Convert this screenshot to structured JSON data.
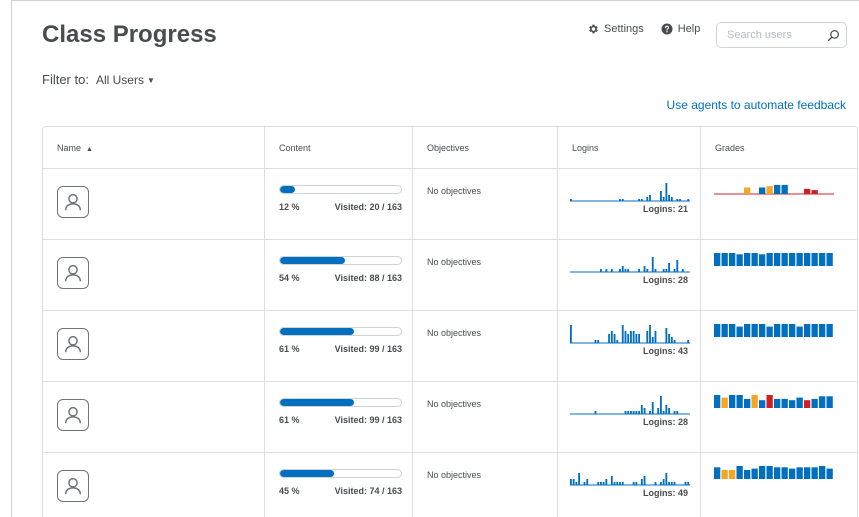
{
  "header": {
    "title": "Class Progress",
    "settings_label": "Settings",
    "help_label": "Help",
    "search_placeholder": "Search users"
  },
  "filter": {
    "label": "Filter to:",
    "value": "All Users"
  },
  "agents_link": "Use agents to automate feedback",
  "columns": {
    "name": "Name",
    "content": "Content",
    "objectives": "Objectives",
    "logins": "Logins",
    "grades": "Grades"
  },
  "colors": {
    "accent": "#006fbf",
    "grade_orange": "#f5a623",
    "grade_red": "#cd2026"
  },
  "rows": [
    {
      "percent_value": 12,
      "percent": "12 %",
      "visited": "Visited: 20 / 163",
      "objectives": "No objectives",
      "logins": "Logins: 21",
      "login_history": [
        1,
        0,
        0,
        0,
        0,
        0,
        0,
        0,
        0,
        0,
        0,
        0,
        0,
        0,
        0,
        0,
        0,
        0,
        1,
        1,
        0,
        0,
        0,
        0,
        0,
        1,
        1,
        0,
        2,
        3,
        0,
        0,
        0,
        5,
        2,
        9,
        3,
        2,
        0,
        1,
        1,
        0,
        0,
        1
      ],
      "grade_style": "line",
      "grades": [
        {
          "v": 0,
          "c": "red"
        },
        {
          "v": 0,
          "c": "red"
        },
        {
          "v": 0,
          "c": "red"
        },
        {
          "v": 0,
          "c": "red"
        },
        {
          "v": 5,
          "c": "orange"
        },
        {
          "v": 0,
          "c": "red"
        },
        {
          "v": 5,
          "c": "blue"
        },
        {
          "v": 6,
          "c": "orange"
        },
        {
          "v": 7,
          "c": "blue"
        },
        {
          "v": 7,
          "c": "blue"
        },
        {
          "v": 0,
          "c": "red"
        },
        {
          "v": 0,
          "c": "red"
        },
        {
          "v": 4,
          "c": "red"
        },
        {
          "v": 3,
          "c": "red"
        },
        {
          "v": 0,
          "c": "red"
        },
        {
          "v": 0,
          "c": "red"
        }
      ]
    },
    {
      "percent_value": 54,
      "percent": "54 %",
      "visited": "Visited: 88 / 163",
      "objectives": "No objectives",
      "logins": "Logins: 28",
      "login_history": [
        0,
        0,
        0,
        0,
        0,
        0,
        0,
        0,
        0,
        0,
        0,
        1,
        0,
        1,
        0,
        1,
        0,
        0,
        1,
        2,
        1,
        1,
        0,
        0,
        0,
        1,
        0,
        2,
        1,
        0,
        5,
        1,
        0,
        0,
        1,
        1,
        3,
        0,
        1,
        4,
        0,
        1,
        0,
        0
      ],
      "grade_style": "full",
      "grades": [
        {
          "v": 10,
          "c": "blue"
        },
        {
          "v": 10,
          "c": "blue"
        },
        {
          "v": 10,
          "c": "blue"
        },
        {
          "v": 9,
          "c": "blue"
        },
        {
          "v": 10,
          "c": "blue"
        },
        {
          "v": 10,
          "c": "blue"
        },
        {
          "v": 9,
          "c": "blue"
        },
        {
          "v": 10,
          "c": "blue"
        },
        {
          "v": 10,
          "c": "blue"
        },
        {
          "v": 10,
          "c": "blue"
        },
        {
          "v": 10,
          "c": "blue"
        },
        {
          "v": 10,
          "c": "blue"
        },
        {
          "v": 10,
          "c": "blue"
        },
        {
          "v": 10,
          "c": "blue"
        },
        {
          "v": 10,
          "c": "blue"
        },
        {
          "v": 10,
          "c": "blue"
        }
      ]
    },
    {
      "percent_value": 61,
      "percent": "61 %",
      "visited": "Visited: 99 / 163",
      "objectives": "No objectives",
      "logins": "Logins: 43",
      "login_history": [
        6,
        0,
        0,
        0,
        0,
        0,
        0,
        0,
        0,
        1,
        1,
        0,
        0,
        0,
        3,
        4,
        3,
        1,
        0,
        6,
        4,
        3,
        4,
        4,
        3,
        3,
        0,
        0,
        4,
        6,
        2,
        4,
        0,
        0,
        0,
        5,
        3,
        2,
        1,
        0,
        0,
        0,
        0,
        1
      ],
      "grade_style": "full",
      "grades": [
        {
          "v": 10,
          "c": "blue"
        },
        {
          "v": 10,
          "c": "blue"
        },
        {
          "v": 10,
          "c": "blue"
        },
        {
          "v": 8,
          "c": "blue"
        },
        {
          "v": 10,
          "c": "blue"
        },
        {
          "v": 10,
          "c": "blue"
        },
        {
          "v": 10,
          "c": "blue"
        },
        {
          "v": 8,
          "c": "blue"
        },
        {
          "v": 10,
          "c": "blue"
        },
        {
          "v": 10,
          "c": "blue"
        },
        {
          "v": 10,
          "c": "blue"
        },
        {
          "v": 8,
          "c": "blue"
        },
        {
          "v": 10,
          "c": "blue"
        },
        {
          "v": 10,
          "c": "blue"
        },
        {
          "v": 10,
          "c": "blue"
        },
        {
          "v": 10,
          "c": "blue"
        }
      ]
    },
    {
      "percent_value": 61,
      "percent": "61 %",
      "visited": "Visited: 99 / 163",
      "objectives": "No objectives",
      "logins": "Logins: 28",
      "login_history": [
        0,
        0,
        0,
        0,
        0,
        0,
        0,
        0,
        0,
        1,
        0,
        0,
        0,
        0,
        0,
        0,
        0,
        0,
        0,
        0,
        1,
        1,
        1,
        1,
        1,
        1,
        3,
        2,
        0,
        1,
        4,
        0,
        2,
        6,
        1,
        3,
        2,
        0,
        1,
        1,
        0,
        0,
        0,
        0
      ],
      "grade_style": "full",
      "grades": [
        {
          "v": 10,
          "c": "blue"
        },
        {
          "v": 8,
          "c": "orange"
        },
        {
          "v": 10,
          "c": "blue"
        },
        {
          "v": 10,
          "c": "blue"
        },
        {
          "v": 7,
          "c": "blue"
        },
        {
          "v": 10,
          "c": "orange"
        },
        {
          "v": 6,
          "c": "blue"
        },
        {
          "v": 10,
          "c": "red"
        },
        {
          "v": 7,
          "c": "blue"
        },
        {
          "v": 7,
          "c": "blue"
        },
        {
          "v": 6,
          "c": "blue"
        },
        {
          "v": 8,
          "c": "blue"
        },
        {
          "v": 6,
          "c": "red"
        },
        {
          "v": 7,
          "c": "blue"
        },
        {
          "v": 9,
          "c": "blue"
        },
        {
          "v": 9,
          "c": "blue"
        }
      ]
    },
    {
      "percent_value": 45,
      "percent": "45 %",
      "visited": "Visited: 74 / 163",
      "objectives": "No objectives",
      "logins": "Logins: 49",
      "login_history": [
        2,
        2,
        1,
        4,
        0,
        1,
        2,
        0,
        0,
        0,
        1,
        1,
        1,
        2,
        0,
        3,
        1,
        1,
        1,
        1,
        0,
        0,
        0,
        1,
        1,
        0,
        2,
        3,
        0,
        0,
        0,
        1,
        0,
        1,
        2,
        4,
        1,
        1,
        1,
        0,
        0,
        0,
        1,
        1
      ],
      "grade_style": "full",
      "grades": [
        {
          "v": 9,
          "c": "blue"
        },
        {
          "v": 7,
          "c": "orange"
        },
        {
          "v": 7,
          "c": "orange"
        },
        {
          "v": 10,
          "c": "blue"
        },
        {
          "v": 7,
          "c": "blue"
        },
        {
          "v": 8,
          "c": "blue"
        },
        {
          "v": 10,
          "c": "blue"
        },
        {
          "v": 10,
          "c": "blue"
        },
        {
          "v": 9,
          "c": "blue"
        },
        {
          "v": 9,
          "c": "blue"
        },
        {
          "v": 8,
          "c": "blue"
        },
        {
          "v": 9,
          "c": "blue"
        },
        {
          "v": 9,
          "c": "blue"
        },
        {
          "v": 9,
          "c": "blue"
        },
        {
          "v": 10,
          "c": "blue"
        },
        {
          "v": 8,
          "c": "blue"
        }
      ]
    }
  ]
}
